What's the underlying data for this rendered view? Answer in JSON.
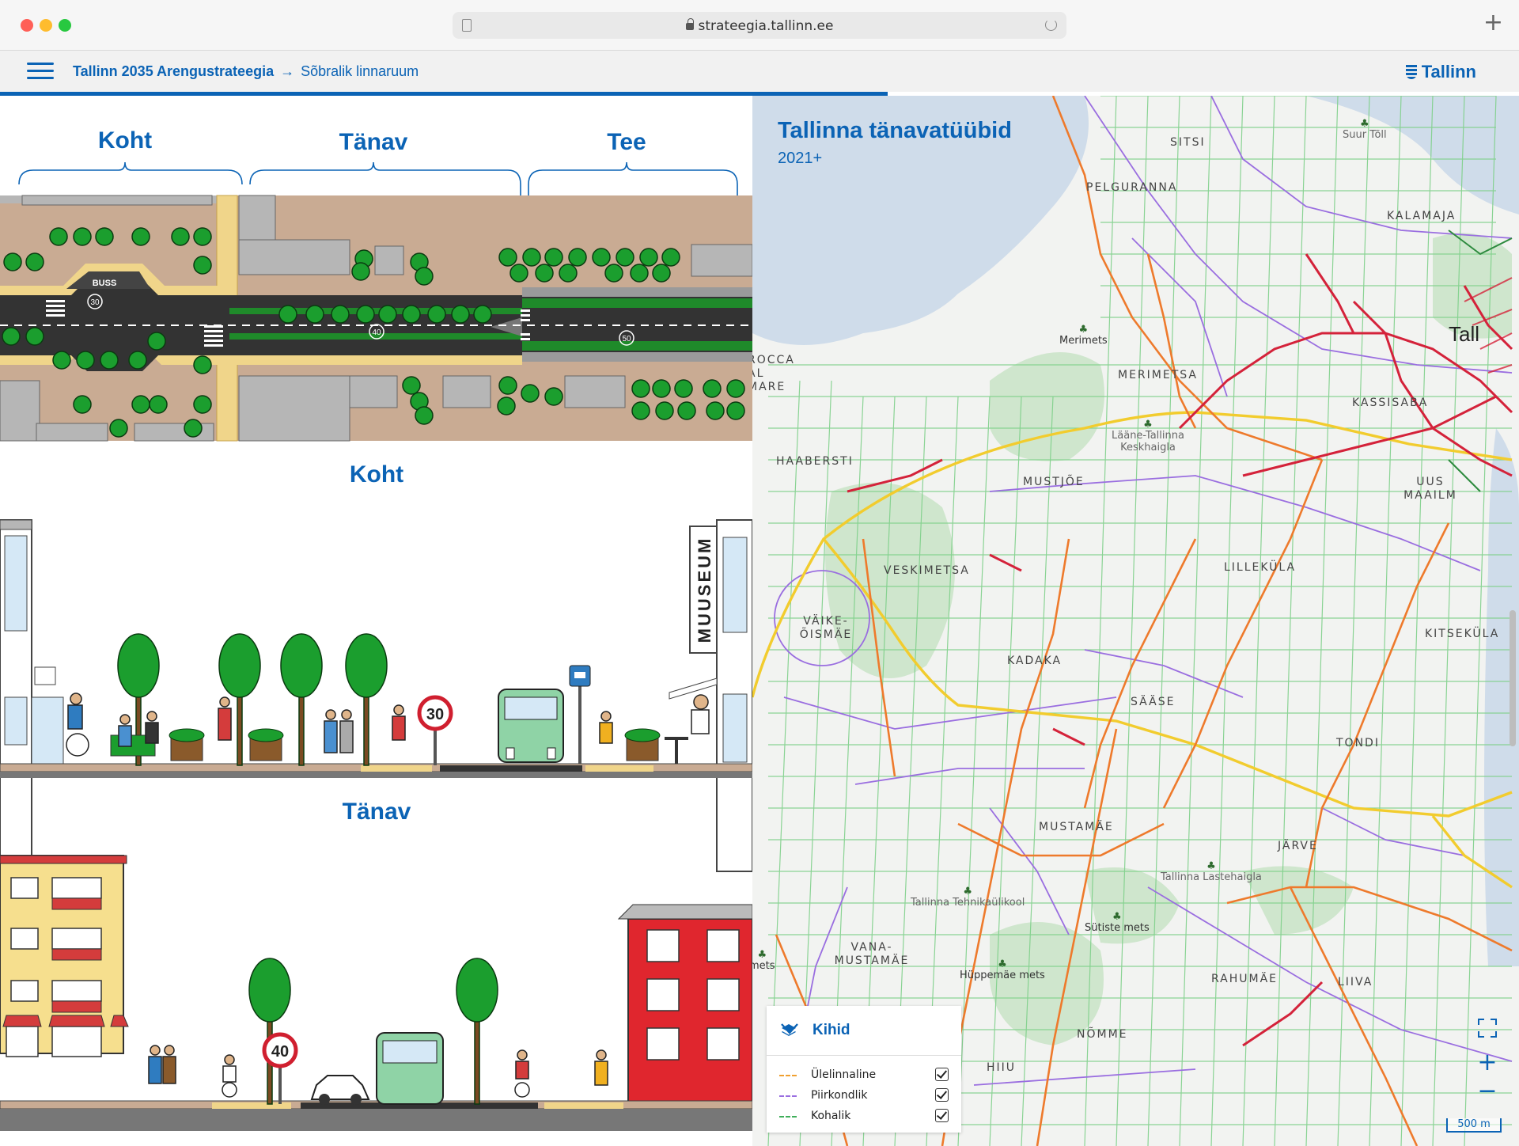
{
  "browser": {
    "url": "strateegia.tallinn.ee",
    "new_tab": "+"
  },
  "header": {
    "breadcrumb_root": "Tallinn 2035 Arengustrateegia",
    "breadcrumb_arrow": "→",
    "breadcrumb_current": "Sõbralik linnaruum",
    "logo": "Tallinn"
  },
  "illustration": {
    "top_labels": [
      "Koht",
      "Tänav",
      "Tee"
    ],
    "bus_label": "BUSS",
    "speed_signs": [
      "30",
      "40",
      "50"
    ],
    "koht_title": "Koht",
    "museum": "MUUSEUM",
    "koht_sign": "30",
    "tanav_title": "Tänav",
    "tanav_sign": "40"
  },
  "map": {
    "title": "Tallinna tänavatüübid",
    "subtitle": "2021+",
    "places": [
      "SITSI",
      "PELGURANNA",
      "KALAMAJA",
      "MERIMETSA",
      "KASSISABA",
      "HAABERSTI",
      "MUSTJÕE",
      "UUS MAAILM",
      "VESKIMETSA",
      "LILLEKÜLA",
      "VÄIKE-ÕISMÄE",
      "KITSEKÜLA",
      "KADAKA",
      "SÄÄSE",
      "TONDI",
      "MUSTAMÄE",
      "JÄRVE",
      "VANA-MUSTAMÄE",
      "RAHUMÄE",
      "LIIVA",
      "NÕMME",
      "HIIU",
      "ROCCA AL MARE",
      "Tall"
    ],
    "pois": [
      "Merimets",
      "Sütiste mets",
      "Hüppemäe mets"
    ],
    "minor_labels": [
      "Suur Tõll",
      "Lääne-Tallinna Keskhaigla",
      "Tallinna Lastehaigla",
      "Tallinna Tehnikaülikool",
      "mets"
    ],
    "layers": {
      "title": "Kihid",
      "items": [
        {
          "label": "Ülelinnaline",
          "color": "#f0a030",
          "checked": true
        },
        {
          "label": "Piirkondlik",
          "color": "#9a6ee0",
          "checked": true
        },
        {
          "label": "Kohalik",
          "color": "#3fae5a",
          "checked": true
        }
      ]
    },
    "zoom_in": "+",
    "zoom_out": "−",
    "scale": "500 m"
  }
}
